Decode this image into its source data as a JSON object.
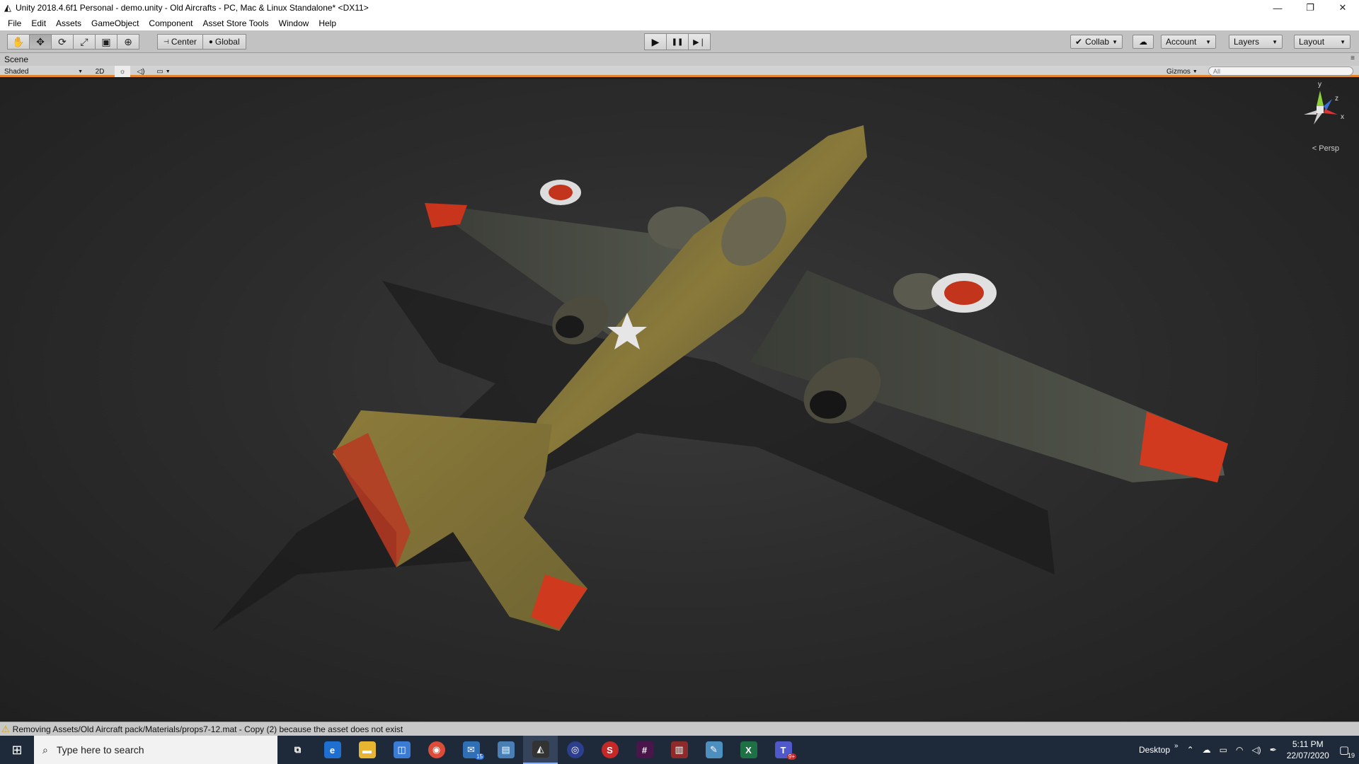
{
  "window": {
    "title": "Unity 2018.4.6f1 Personal - demo.unity - Old Aircrafts - PC, Mac & Linux Standalone* <DX11>",
    "minimize": "—",
    "restore": "❐",
    "close": "✕"
  },
  "menu": [
    "File",
    "Edit",
    "Assets",
    "GameObject",
    "Component",
    "Asset Store Tools",
    "Window",
    "Help"
  ],
  "toolbar": {
    "tools": [
      {
        "name": "hand-tool",
        "glyph": "✋"
      },
      {
        "name": "move-tool",
        "glyph": "✥"
      },
      {
        "name": "rotate-tool",
        "glyph": "⟳"
      },
      {
        "name": "scale-tool",
        "glyph": "⤢"
      },
      {
        "name": "rect-tool",
        "glyph": "▣"
      },
      {
        "name": "transform-tool",
        "glyph": "⊕"
      }
    ],
    "pivot_center": "Center",
    "pivot_global": "Global",
    "play": "▶",
    "pause": "❚❚",
    "step": "▶❘",
    "collab": "Collab",
    "cloud": "☁",
    "account": "Account",
    "layers": "Layers",
    "layout": "Layout"
  },
  "scene": {
    "tab_label": "Scene",
    "shading_mode": "Shaded",
    "mode_2d": "2D",
    "lighting_glyph": "☼",
    "audio_glyph": "🔊",
    "effects_glyph": "▭",
    "gizmos": "Gizmos",
    "search_placeholder": "All",
    "projection": "Persp",
    "axis_y": "y",
    "axis_z": "z",
    "axis_x": "x"
  },
  "console": {
    "message": "Removing Assets/Old Aircraft pack/Materials/props7-12.mat - Copy (2) because the asset does not exist"
  },
  "taskbar": {
    "search_placeholder": "Type here to search",
    "apps": [
      {
        "name": "task-view",
        "glyph": "⧉",
        "color": "#1e2a3a"
      },
      {
        "name": "edge",
        "glyph": "e",
        "color": "#1f6fd0"
      },
      {
        "name": "file-explorer",
        "glyph": "▬",
        "color": "#e8b530"
      },
      {
        "name": "store",
        "glyph": "◫",
        "color": "#3a7bd5"
      },
      {
        "name": "chrome",
        "glyph": "◉",
        "color": "#dd4b39"
      },
      {
        "name": "mail",
        "glyph": "✉",
        "color": "#2f6fb5",
        "badge": "15"
      },
      {
        "name": "remote-desktop",
        "glyph": "▤",
        "color": "#4a7fb5"
      },
      {
        "name": "unity",
        "glyph": "◭",
        "color": "#333333"
      },
      {
        "name": "cinema4d",
        "glyph": "◎",
        "color": "#2b3f8c"
      },
      {
        "name": "substance",
        "glyph": "S",
        "color": "#c62828"
      },
      {
        "name": "slack",
        "glyph": "#",
        "color": "#4a154b"
      },
      {
        "name": "winrar",
        "glyph": "▥",
        "color": "#8e2a2a"
      },
      {
        "name": "paint",
        "glyph": "✎",
        "color": "#4d8fbf"
      },
      {
        "name": "excel",
        "glyph": "X",
        "color": "#1e7145"
      },
      {
        "name": "teams",
        "glyph": "T",
        "color": "#5059c9",
        "badge": "9+"
      }
    ],
    "desktop_label": "Desktop",
    "time": "5:11 PM",
    "date": "22/07/2020",
    "notifications": "19"
  }
}
